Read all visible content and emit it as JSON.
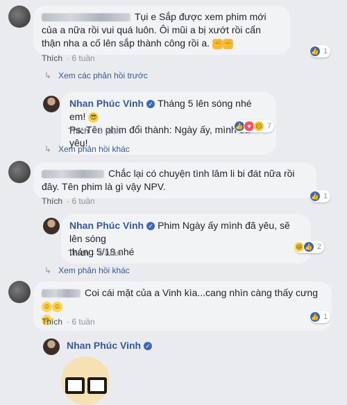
{
  "comments": [
    {
      "id": "c1",
      "text": "Tụi e Sắp được xem phim mới của a nữa rồi vui quá luôn. Ôi mũi a bị xướt rồi cẩn thận nha a cố lên sắp thành công rồi a.",
      "like_label": "Thích",
      "time": "6 tuần",
      "reaction_count": "1"
    },
    {
      "id": "c2",
      "text": "Chắc lại có chuyện tình lâm li bi đát nữa rồi đây. Tên phim là gì vậy NPV.",
      "like_label": "Thích",
      "time": "6 tuần",
      "reaction_count": "1"
    },
    {
      "id": "c3",
      "text": "Coi cái mặt của a Vinh kìa...cang nhìn càng thấy cưng",
      "like_label": "Thích",
      "time": "6 tuần",
      "reaction_count": "1"
    }
  ],
  "replies": [
    {
      "author": "Nhan Phúc Vinh",
      "line1": "Tháng 5 lên sóng nhé em!",
      "line2": "Ps: Tên phim đổi thành: Ngày ấy, mình đã yêu!",
      "like_label": "Thích",
      "time": "6 tuần",
      "reaction_count": "7"
    },
    {
      "author": "Nhan Phúc Vinh",
      "line1": "Phim Ngày ấy mình đã yêu, sẽ lên sóng",
      "line2": "tháng 5/18 nhé",
      "like_label": "Thích",
      "time": "6 tuần",
      "reaction_count": "2"
    },
    {
      "author": "Nhan Phúc Vinh"
    }
  ],
  "links": {
    "view_previous": "Xem các phản hồi trước",
    "view_other_1": "Xem phản hồi khác",
    "view_other_2": "Xem phản hồi khác"
  },
  "colors": {
    "link": "#365899",
    "meta": "#90949c",
    "bubble": "#f2f3f5",
    "background": "#e9ebee",
    "like_blue": "#4267b2"
  }
}
